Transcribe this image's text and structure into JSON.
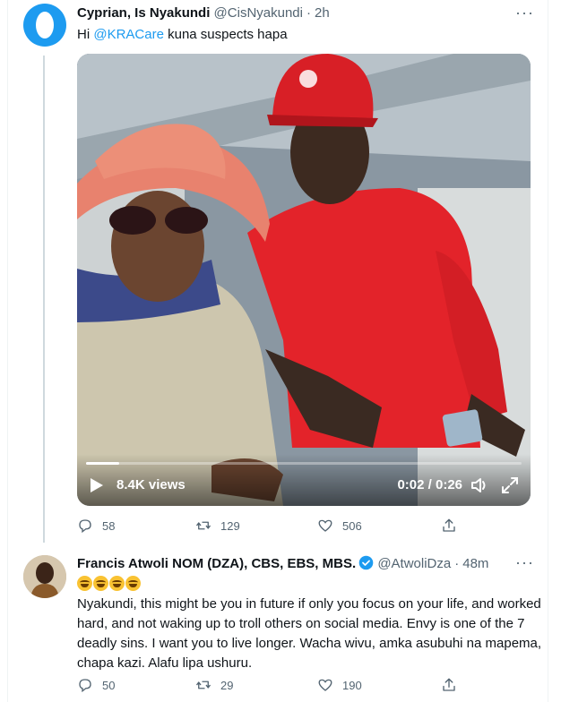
{
  "tweet1": {
    "author_name": "Cyprian, Is Nyakundi",
    "handle": "@CisNyakundi",
    "separator": "·",
    "time": "2h",
    "more_label": "···",
    "text_prefix": "Hi ",
    "mention": "@KRACare",
    "text_suffix": " kuna suspects hapa",
    "video": {
      "views": "8.4K views",
      "timecode": "0:02 / 0:26",
      "progress": 0.077
    },
    "actions": {
      "replies": "58",
      "retweets": "129",
      "likes": "506"
    }
  },
  "tweet2": {
    "author_name": "Francis Atwoli NOM (DZA), CBS, EBS, MBS.",
    "handle": "@AtwoliDza",
    "separator": "·",
    "time": "48m",
    "more_label": "···",
    "emoji_count": 4,
    "text": "Nyakundi, this might be you in future if only you focus on your life, and worked hard, and not waking up to troll others on social media. Envy is one of the 7 deadly sins. I want you to live longer. Wacha wivu, amka asubuhi na mapema, chapa kazi. Alafu lipa ushuru.",
    "actions": {
      "replies": "50",
      "retweets": "29",
      "likes": "190"
    }
  },
  "colors": {
    "accent": "#1d9bf0",
    "secondary_text": "#536471",
    "thread_line": "#cfd9de"
  },
  "icons": [
    "reply-icon",
    "retweet-icon",
    "like-icon",
    "share-icon",
    "verified-badge-icon",
    "play-icon",
    "volume-icon",
    "fullscreen-icon",
    "more-icon"
  ]
}
